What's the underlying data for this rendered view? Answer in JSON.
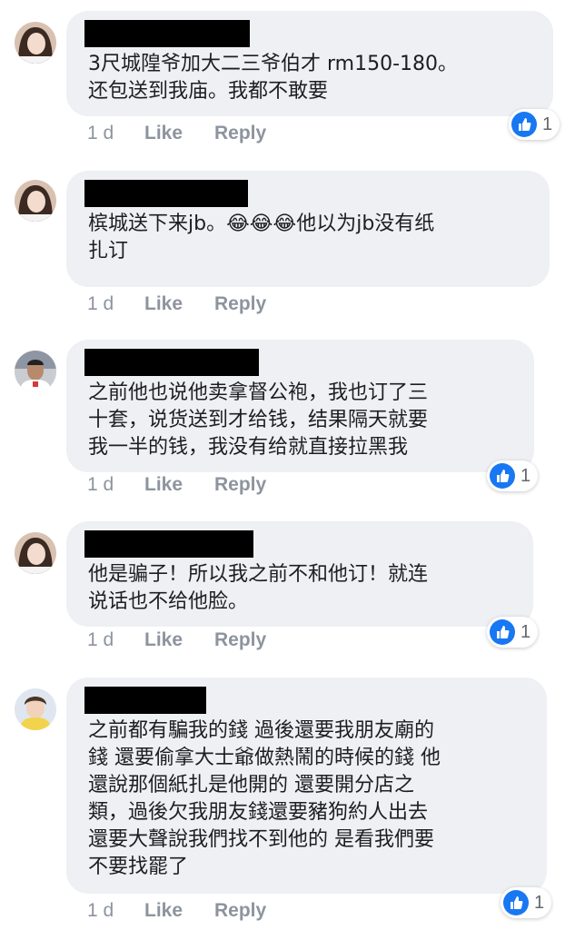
{
  "comments": [
    {
      "text": "3尺城隍爷加大二三爷伯才 rm150-180。\n还包送到我庙。我都不敢要",
      "time": "1 d",
      "like_label": "Like",
      "reply_label": "Reply",
      "reactions": {
        "icon": "thumbs-up-icon",
        "count": "1"
      }
    },
    {
      "text_before": "槟城送下来jb。",
      "emojis": "😂😂😂",
      "text_after": "他以为jb没有纸\n扎订",
      "time": "1 d",
      "like_label": "Like",
      "reply_label": "Reply"
    },
    {
      "text": "之前他也说他卖拿督公袍，我也订了三\n十套，说货送到才给钱，结果隔天就要\n我一半的钱，我没有给就直接拉黑我",
      "time": "1 d",
      "like_label": "Like",
      "reply_label": "Reply",
      "reactions": {
        "icon": "thumbs-up-icon",
        "count": "1"
      }
    },
    {
      "text": "他是骗子！所以我之前不和他订！就连\n说话也不给他脸。",
      "time": "1 d",
      "like_label": "Like",
      "reply_label": "Reply",
      "reactions": {
        "icon": "thumbs-up-icon",
        "count": "1"
      }
    },
    {
      "text": "之前都有騙我的錢 過後還要我朋友廟的\n錢 還要偷拿大士爺做熱鬧的時候的錢 他\n還說那個紙扎是他開的 還要開分店之\n類，過後欠我朋友錢還要豬狗約人出去\n還要大聲說我們找不到他的 是看我們要\n不要找罷了",
      "time": "1 d",
      "like_label": "Like",
      "reply_label": "Reply",
      "reactions": {
        "icon": "thumbs-up-icon",
        "count": "1"
      }
    }
  ],
  "colors": {
    "bubble_bg": "#eef0f3",
    "meta_text": "#8d949e",
    "like_blue": "#1877f2"
  }
}
